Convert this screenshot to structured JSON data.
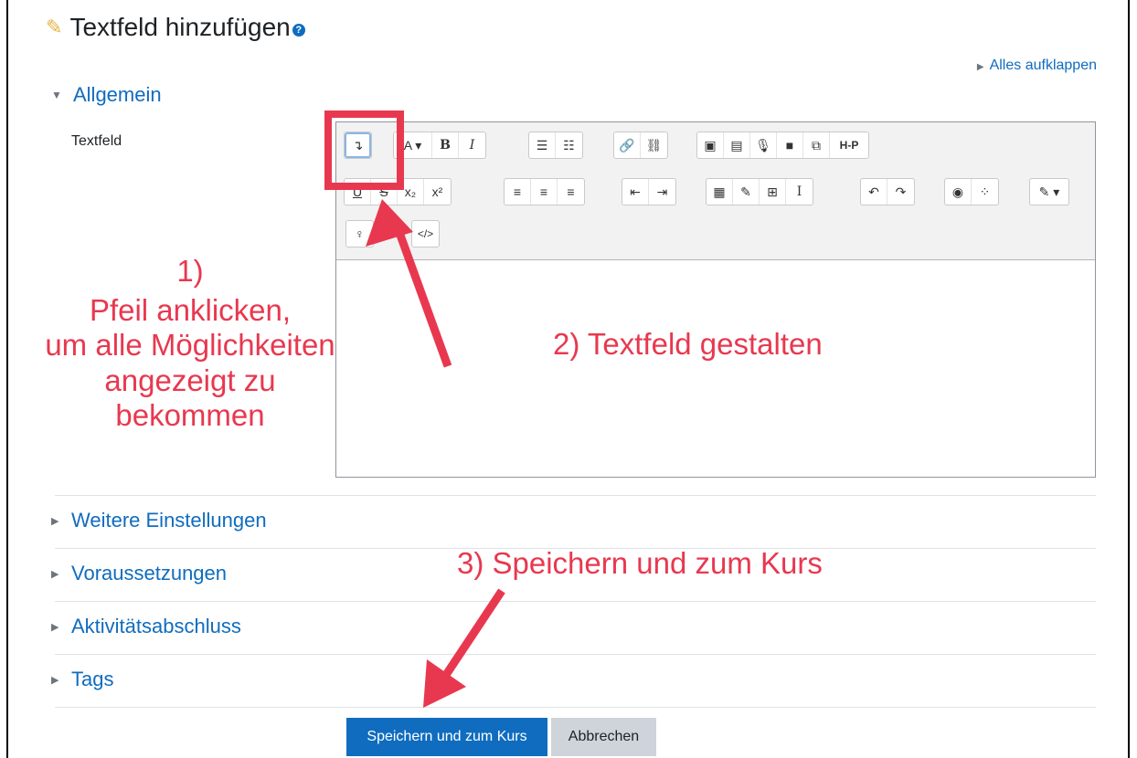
{
  "page": {
    "title": "Textfeld hinzufügen",
    "help_icon": "question-circle-icon",
    "title_icon": "pencil-icon",
    "expand_all": "Alles aufklappen"
  },
  "sections": {
    "general": "Allgemein",
    "field_label": "Textfeld",
    "collapsed": [
      {
        "label": "Weitere Einstellungen"
      },
      {
        "label": "Voraussetzungen"
      },
      {
        "label": "Aktivitätsabschluss"
      },
      {
        "label": "Tags"
      }
    ]
  },
  "toolbar": {
    "row1": {
      "toggle": "↴",
      "font": "A ▾",
      "bold": "B",
      "italic": "I",
      "ul": "☰",
      "ol": "☷",
      "link": "🔗",
      "unlink": "⛓",
      "image": "▣",
      "media": "▤",
      "record_audio": "🎙",
      "record_video": "■",
      "manage_files": "⧉",
      "h5p": "H-P"
    },
    "row2": {
      "underline": "U",
      "strike": "S",
      "sub": "x₂",
      "sup": "x²",
      "align_left": "≡",
      "align_center": "≡",
      "align_right": "≡",
      "outdent": "⇤",
      "indent": "⇥",
      "equation": "▦",
      "chars": "✎",
      "table": "⊞",
      "clear": "I",
      "undo": "↶",
      "redo": "↷",
      "accessibility": "◉",
      "screenreader": "⁘",
      "paint": "✎ ▾"
    },
    "row3": {
      "bulb": "♀",
      "html": "</>"
    }
  },
  "buttons": {
    "save": "Speichern und zum Kurs",
    "cancel": "Abbrechen"
  },
  "annotations": {
    "step1_num": "1)",
    "step1_line1": "Pfeil anklicken,",
    "step1_line2": "um alle Möglichkeiten",
    "step1_line3": "angezeigt zu bekommen",
    "step2": "2) Textfeld gestalten",
    "step3": "3) Speichern und zum Kurs",
    "color": "#e8384f"
  }
}
